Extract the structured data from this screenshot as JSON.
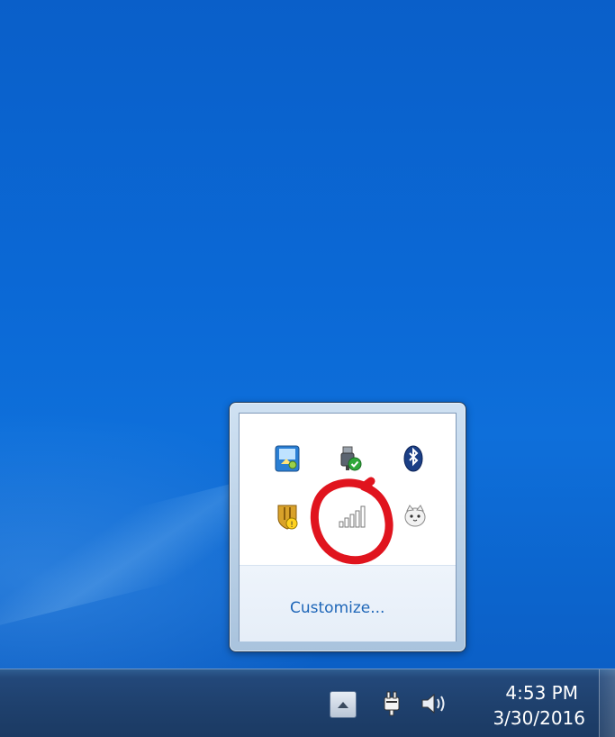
{
  "overflow_tray": {
    "icons": [
      {
        "name": "network-center-icon"
      },
      {
        "name": "usb-safely-remove-icon"
      },
      {
        "name": "bluetooth-icon"
      },
      {
        "name": "security-shield-icon"
      },
      {
        "name": "signal-strength-icon"
      },
      {
        "name": "cat-app-icon"
      }
    ],
    "customize_label": "Customize..."
  },
  "taskbar": {
    "show_hidden_icons": "show-hidden-icons-button",
    "time": "4:53 PM",
    "date": "3/30/2016"
  },
  "colors": {
    "desktop": "#0b69d6",
    "taskbar": "#1f416e",
    "link": "#1e66b8",
    "annotation": "#e0141e"
  }
}
